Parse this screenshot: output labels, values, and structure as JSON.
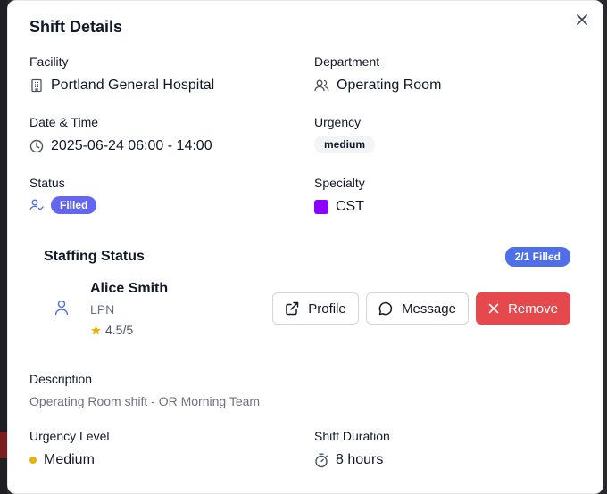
{
  "modal": {
    "title": "Shift Details"
  },
  "facility": {
    "label": "Facility",
    "value": "Portland General Hospital"
  },
  "department": {
    "label": "Department",
    "value": "Operating Room"
  },
  "datetime": {
    "label": "Date & Time",
    "value": "2025-06-24 06:00 - 14:00"
  },
  "urgency": {
    "label": "Urgency",
    "value": "medium"
  },
  "status": {
    "label": "Status",
    "value": "Filled"
  },
  "specialty": {
    "label": "Specialty",
    "value": "CST",
    "color": "#8b00ff"
  },
  "staffing": {
    "title": "Staffing Status",
    "filled_badge": "2/1 Filled",
    "staff": {
      "name": "Alice Smith",
      "role": "LPN",
      "rating": "4.5/5"
    },
    "buttons": {
      "profile": "Profile",
      "message": "Message",
      "remove": "Remove"
    }
  },
  "description": {
    "label": "Description",
    "text": "Operating Room shift - OR Morning Team"
  },
  "urgency_level": {
    "label": "Urgency Level",
    "value": "Medium",
    "color": "#eab308"
  },
  "shift_duration": {
    "label": "Shift Duration",
    "value": "8 hours"
  },
  "colors": {
    "accent": "#6366f1",
    "filled_badge": "#4f6fe8",
    "danger": "#e5484d"
  }
}
